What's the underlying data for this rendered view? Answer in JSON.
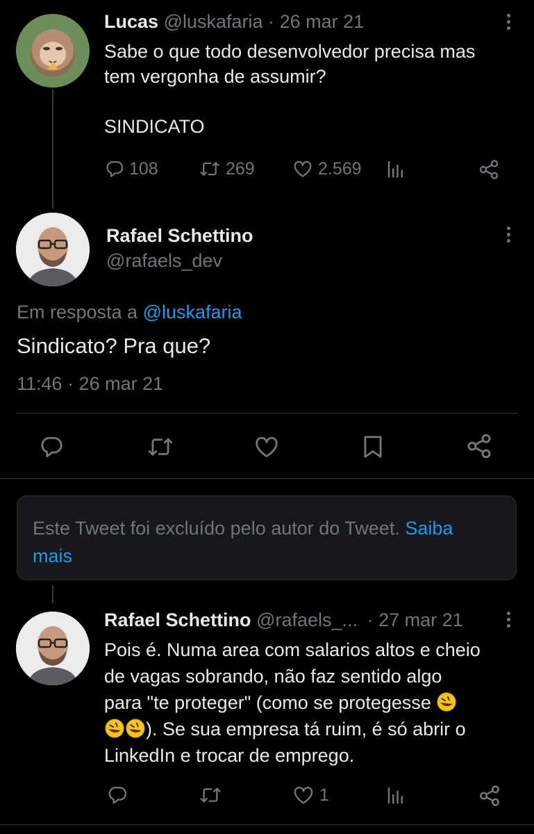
{
  "tweet1": {
    "name": "Lucas",
    "handle": "@luskafaria",
    "sep": "·",
    "date": "26 mar 21",
    "line1": "Sabe o que todo desenvolvedor precisa mas",
    "line2": "tem vergonha de assumir?",
    "line3": "SINDICATO",
    "replies": "108",
    "retweets": "269",
    "likes": "2.569"
  },
  "tweet2": {
    "name": "Rafael Schettino",
    "handle": "@rafaels_dev",
    "reply_prefix": "Em resposta a",
    "reply_to": "@luskafaria",
    "text": "Sindicato? Pra que?",
    "timestamp": "11:46 · 26 mar 21"
  },
  "deleted_notice": {
    "text_line1": "Este Tweet foi excluído pelo autor do Tweet.",
    "link1": "Saiba",
    "link2": "mais"
  },
  "tweet3": {
    "name": "Rafael Schettino",
    "handle": "@rafaels_...",
    "sep": "·",
    "date": "27 mar 21",
    "line1": "Pois é. Numa area com salarios altos e cheio",
    "line2": "de vagas sobrando, não faz sentido algo",
    "line3": "para \"te proteger\" (como se protegesse",
    "line4": "). Se sua empresa tá ruim, é só abrir o",
    "line5": "LinkedIn e trocar de emprego.",
    "likes": "1"
  },
  "colors": {
    "background": "#000000",
    "text": "#e7e9ea",
    "muted": "#71767b",
    "link": "#1d9bf0",
    "card": "#16181c"
  },
  "icons": [
    "reply-icon",
    "retweet-icon",
    "like-icon",
    "views-icon",
    "share-icon",
    "bookmark-icon",
    "more-icon",
    "rofl-emoji"
  ]
}
